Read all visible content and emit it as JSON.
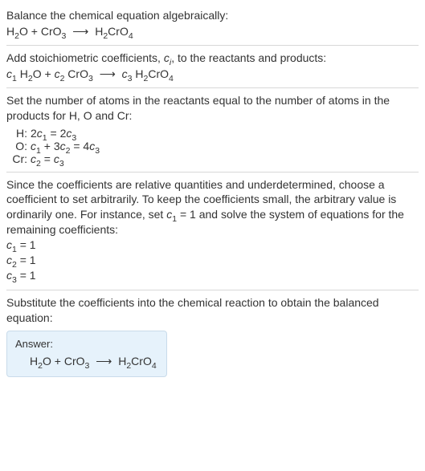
{
  "section1": {
    "text": "Balance the chemical equation algebraically:"
  },
  "section2": {
    "text": "Add stoichiometric coefficients, ",
    "ci": "c",
    "ci_sub": "i",
    "text2": ", to the reactants and products:"
  },
  "section3": {
    "text": "Set the number of atoms in the reactants equal to the number of atoms in the products for H, O and Cr:",
    "rows": [
      {
        "label": "H:"
      },
      {
        "label": "O:"
      },
      {
        "label": "Cr:"
      }
    ]
  },
  "section4": {
    "text": "Since the coefficients are relative quantities and underdetermined, choose a coefficient to set arbitrarily. To keep the coefficients small, the arbitrary value is ordinarily one. For instance, set ",
    "c1": "c",
    "c1_sub": "1",
    "text2": " = 1 and solve the system of equations for the remaining coefficients:",
    "lines": [
      {
        "lhs": "c",
        "sub": "1",
        "rhs": " = 1"
      },
      {
        "lhs": "c",
        "sub": "2",
        "rhs": " = 1"
      },
      {
        "lhs": "c",
        "sub": "3",
        "rhs": " = 1"
      }
    ]
  },
  "section5": {
    "text": "Substitute the coefficients into the chemical reaction to obtain the balanced equation:"
  },
  "answer": {
    "label": "Answer:"
  },
  "chem": {
    "H2O": {
      "p1": "H",
      "s1": "2",
      "p2": "O"
    },
    "CrO3": {
      "p1": "CrO",
      "s1": "3"
    },
    "H2CrO4": {
      "p1": "H",
      "s1": "2",
      "p2": "CrO",
      "s2": "4"
    },
    "plus": " + ",
    "arrow": "⟶"
  },
  "coef_eqn": {
    "c1": "c",
    "c1s": "1",
    "c2": "c",
    "c2s": "2",
    "c3": "c",
    "c3s": "3",
    "sp": " "
  },
  "atom_eqs": {
    "H": {
      "lhs_a": "2",
      "lhs_c": "c",
      "lhs_s": "1",
      "eq": " = ",
      "rhs_a": "2",
      "rhs_c": "c",
      "rhs_s": "3"
    },
    "O": {
      "l1c": "c",
      "l1s": "1",
      "plus": " + ",
      "l2a": "3",
      "l2c": "c",
      "l2s": "2",
      "eq": " = ",
      "ra": "4",
      "rc": "c",
      "rs": "3"
    },
    "Cr": {
      "lc": "c",
      "ls": "2",
      "eq": " = ",
      "rc": "c",
      "rs": "3"
    }
  }
}
